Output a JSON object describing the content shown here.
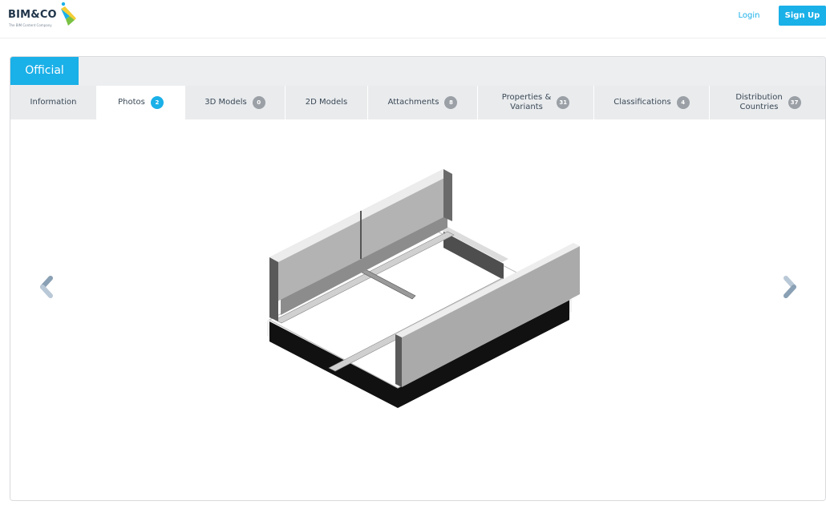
{
  "header": {
    "logo_text": "BIM&CO",
    "logo_tagline": "The BIM Content Company",
    "login_label": "Login",
    "signup_label": "Sign Up",
    "accent_color": "#1ab0e8"
  },
  "product": {
    "status_tab": "Official"
  },
  "tabs": [
    {
      "label": "Information",
      "badge": ""
    },
    {
      "label": "Photos",
      "badge": "2"
    },
    {
      "label": "3D Models",
      "badge": "0"
    },
    {
      "label": "2D Models",
      "badge": ""
    },
    {
      "label": "Attachments",
      "badge": "8"
    },
    {
      "label": "Properties &\nVariants",
      "badge": "31"
    },
    {
      "label": "Classifications",
      "badge": "4"
    },
    {
      "label": "Distribution\nCountries",
      "badge": "37"
    }
  ],
  "active_tab": "Photos",
  "viewer": {
    "prev_icon": "chevron-left-icon",
    "next_icon": "chevron-right-icon"
  }
}
